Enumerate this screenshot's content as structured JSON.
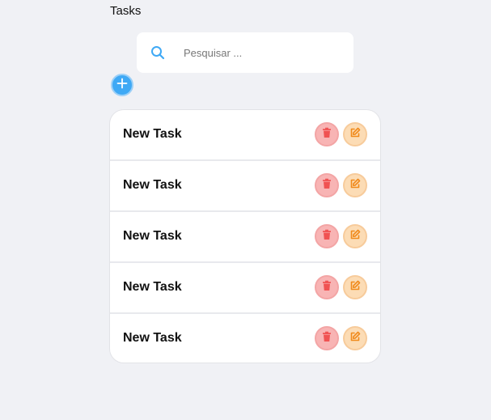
{
  "header": {
    "title": "Tasks"
  },
  "search": {
    "placeholder": "Pesquisar ..."
  },
  "colors": {
    "accent": "#3fa9f5",
    "delete": "#f05252",
    "edit": "#f08a1c"
  },
  "tasks": [
    {
      "title": "New Task"
    },
    {
      "title": "New Task"
    },
    {
      "title": "New Task"
    },
    {
      "title": "New Task"
    },
    {
      "title": "New Task"
    }
  ]
}
